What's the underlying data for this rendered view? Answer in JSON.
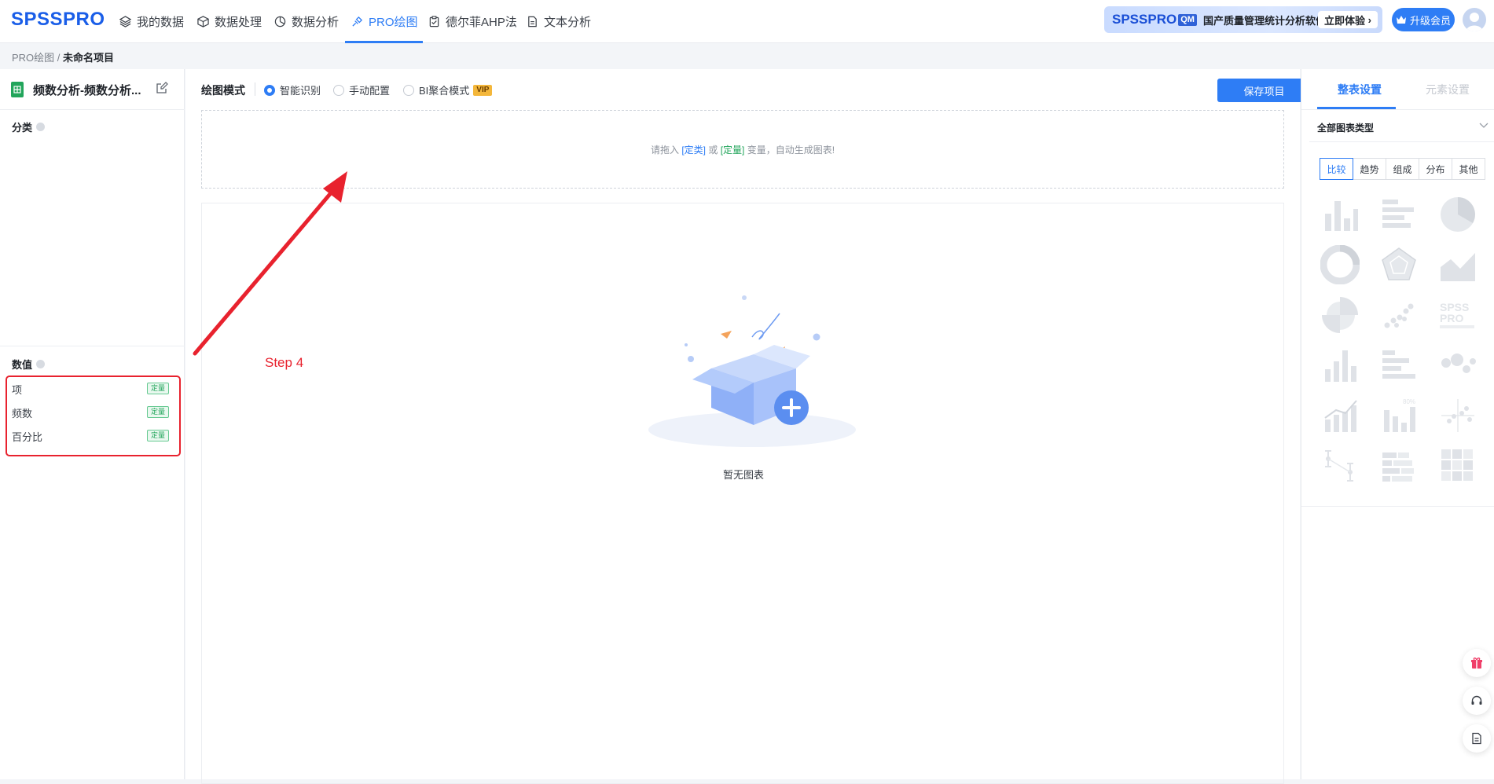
{
  "app": {
    "logo": "SPSSPRO"
  },
  "nav": {
    "items": [
      {
        "label": "我的数据",
        "icon": "layers-icon"
      },
      {
        "label": "数据处理",
        "icon": "cube-icon"
      },
      {
        "label": "数据分析",
        "icon": "pie-icon"
      },
      {
        "label": "PRO绘图",
        "icon": "brush-icon",
        "active": true
      },
      {
        "label": "德尔菲AHP法",
        "icon": "clipboard-check-icon"
      },
      {
        "label": "文本分析",
        "icon": "document-icon"
      }
    ],
    "banner": {
      "logo": "SPSSPRO",
      "badge": "QM",
      "text": "国产质量管理统计分析软件",
      "button": "立即体验"
    },
    "upgrade_label": "升级会员"
  },
  "breadcrumb": {
    "parent": "PRO绘图",
    "separator": "/",
    "current": "未命名项目"
  },
  "left": {
    "file_title": "频数分析-频数分析...",
    "category_title": "分类",
    "numeric_title": "数值",
    "variables": [
      {
        "name": "项",
        "tag": "定量"
      },
      {
        "name": "频数",
        "tag": "定量"
      },
      {
        "name": "百分比",
        "tag": "定量"
      }
    ]
  },
  "center": {
    "mode_label": "绘图模式",
    "modes": [
      {
        "label": "智能识别",
        "selected": true
      },
      {
        "label": "手动配置",
        "selected": false
      },
      {
        "label": "BI聚合模式",
        "selected": false,
        "badge": "VIP"
      }
    ],
    "save_label": "保存项目",
    "drop_hint": {
      "prefix": "请拖入",
      "cat": "[定类]",
      "or": "或",
      "quant": "[定量]",
      "suffix": "变量，自动生成图表!"
    },
    "empty_text": "暂无图表"
  },
  "annotation": {
    "step_label": "Step 4",
    "color": "#e8222e"
  },
  "right": {
    "tab_active": "整表设置",
    "tab_inactive": "元素设置",
    "chart_type_label": "全部图表类型",
    "categories": [
      "比较",
      "趋势",
      "组成",
      "分布",
      "其他"
    ],
    "selected_category": "比较",
    "chart_icons": [
      "bar-chart-icon",
      "horizontal-bar-icon",
      "pie-chart-icon",
      "donut-chart-icon",
      "radar-chart-icon",
      "area-chart-icon",
      "rose-chart-icon",
      "scatter-chart-icon",
      "spsspro-logo-icon",
      "bar-chart-icon",
      "horizontal-bar-icon",
      "bubble-chart-icon",
      "bar-line-combo-icon",
      "percent-bar-icon",
      "scatter-cross-icon",
      "error-bar-icon",
      "stacked-bar-icon",
      "heatmap-grid-icon"
    ]
  },
  "floating": [
    "gift-icon",
    "headset-icon",
    "doc-icon"
  ],
  "colors": {
    "primary": "#2e7df5",
    "quant_tag": "#22a55b",
    "highlight": "#e8222e"
  }
}
